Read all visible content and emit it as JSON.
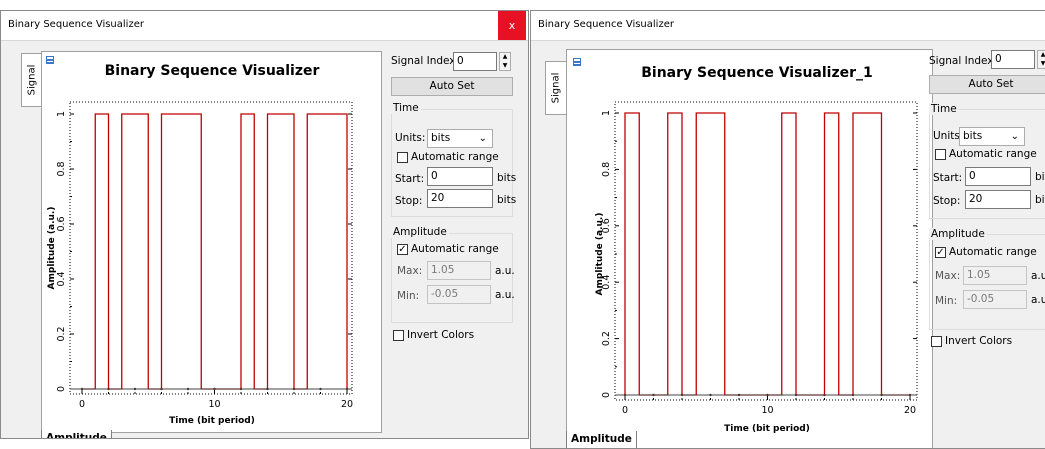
{
  "windows": [
    {
      "title": "Binary Sequence Visualizer",
      "plot_title": "Binary Sequence Visualizer",
      "side_tab": "Signal",
      "bottom_tab": "Amplitude",
      "close_label": "x",
      "signal_index_label": "Signal Index:",
      "signal_index_value": "0",
      "auto_set_label": "Auto Set",
      "time_group": "Time",
      "units_label": "Units:",
      "units_value": "bits",
      "time_auto_range_label": "Automatic range",
      "start_label": "Start:",
      "start_value": "0",
      "stop_label": "Stop:",
      "stop_value": "20",
      "time_unit": "bits",
      "amplitude_group": "Amplitude",
      "amp_auto_range_label": "Automatic range",
      "max_label": "Max:",
      "max_value": "1.05",
      "min_label": "Min:",
      "min_value": "-0.05",
      "amp_unit": "a.u.",
      "invert_colors_label": "Invert Colors",
      "chart_data": {
        "type": "line",
        "title": "Binary Sequence Visualizer",
        "xlabel": "Time (bit period)",
        "ylabel": "Amplitude (a.u.)",
        "xlim": [
          0,
          20
        ],
        "ylim": [
          -0.05,
          1.05
        ],
        "x_ticks": [
          "0",
          "10",
          "20"
        ],
        "y_ticks": [
          "0",
          "0.2",
          "0.4",
          "0.6",
          "0.8",
          "1"
        ],
        "series": [
          {
            "color": "#c00000",
            "bits": [
              0,
              1,
              0,
              1,
              1,
              0,
              1,
              1,
              1,
              0,
              0,
              0,
              1,
              0,
              1,
              1,
              0,
              1,
              1,
              1
            ]
          }
        ]
      }
    },
    {
      "title": "Binary Sequence Visualizer",
      "plot_title": "Binary Sequence Visualizer_1",
      "side_tab": "Signal",
      "bottom_tab": "Amplitude",
      "signal_index_label": "Signal Index:",
      "signal_index_value": "0",
      "auto_set_label": "Auto Set",
      "time_group": "Time",
      "units_label": "Units:",
      "units_value": "bits",
      "time_auto_range_label": "Automatic range",
      "start_label": "Start:",
      "start_value": "0",
      "stop_label": "Stop:",
      "stop_value": "20",
      "time_unit": "bits",
      "amplitude_group": "Amplitude",
      "amp_auto_range_label": "Automatic range",
      "max_label": "Max:",
      "max_value": "1.05",
      "min_label": "Min:",
      "min_value": "-0.05",
      "amp_unit": "a.u.",
      "invert_colors_label": "Invert Colors",
      "chart_data": {
        "type": "line",
        "title": "Binary Sequence Visualizer_1",
        "xlabel": "Time (bit period)",
        "ylabel": "Amplitude (a.u.)",
        "xlim": [
          0,
          20
        ],
        "ylim": [
          -0.05,
          1.05
        ],
        "x_ticks": [
          "0",
          "10",
          "20"
        ],
        "y_ticks": [
          "0",
          "0.2",
          "0.4",
          "0.6",
          "0.8",
          "1"
        ],
        "series": [
          {
            "color": "#c00000",
            "bits": [
              1,
              0,
              0,
              1,
              0,
              1,
              1,
              0,
              0,
              0,
              0,
              1,
              0,
              0,
              1,
              0,
              1,
              1,
              0,
              0
            ]
          }
        ]
      }
    }
  ]
}
